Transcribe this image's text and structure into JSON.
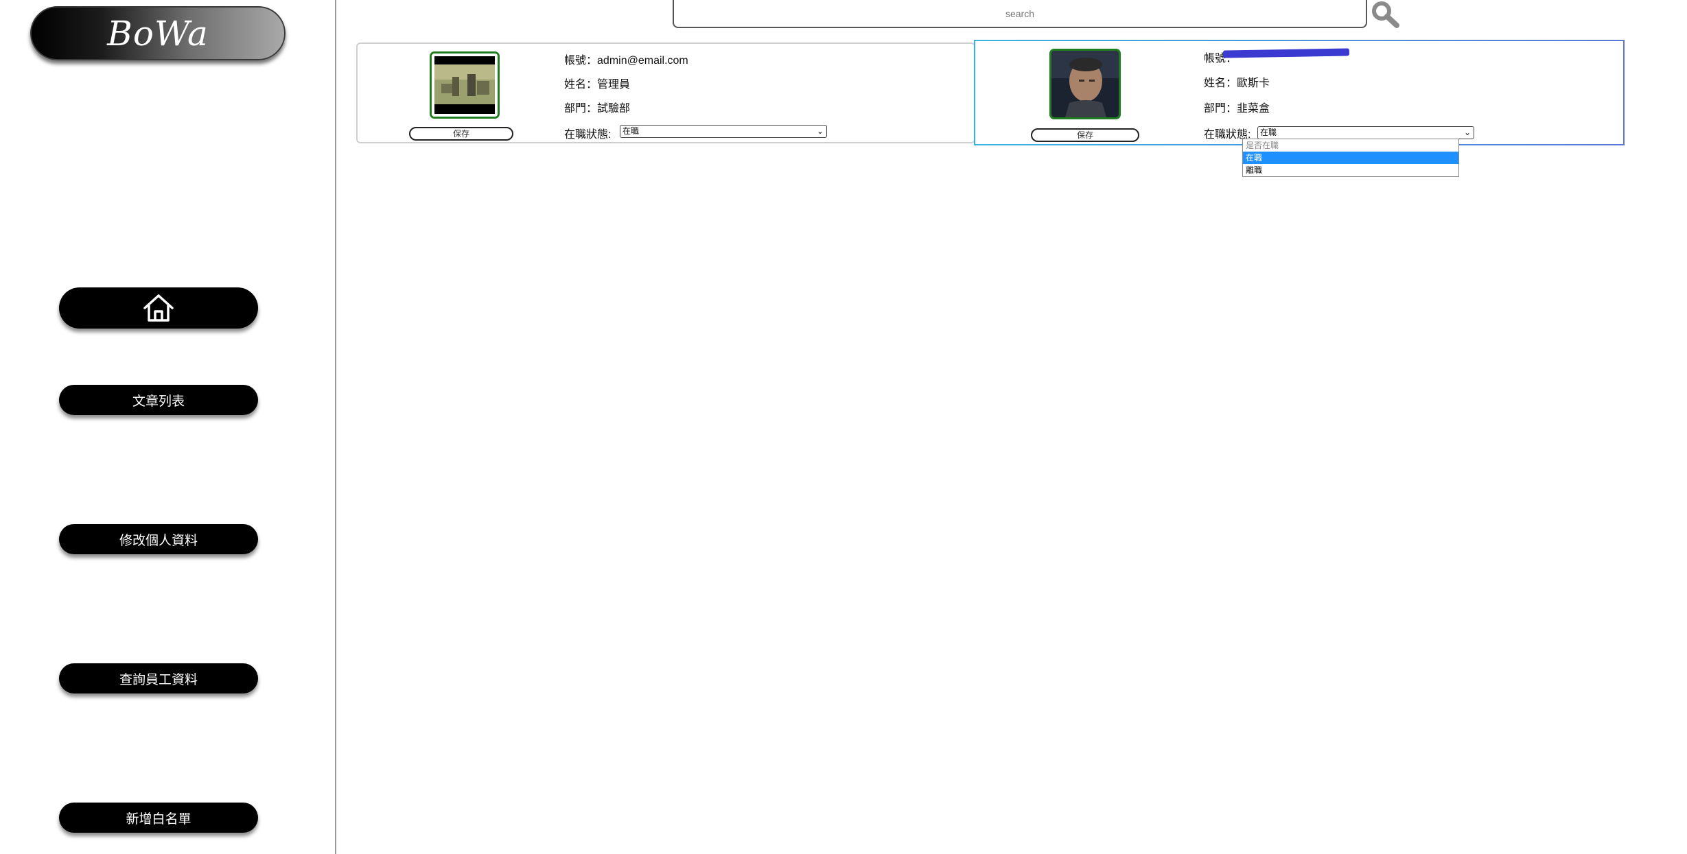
{
  "sidebar": {
    "logo": "BoWa",
    "nav": [
      "文章列表",
      "修改個人資料",
      "查詢員工資料",
      "新增白名單"
    ]
  },
  "search": {
    "placeholder": "search"
  },
  "cards": [
    {
      "account_label": "帳號：",
      "account": "admin@email.com",
      "name_label": "姓名：",
      "name": "管理員",
      "dept_label": "部門：",
      "dept": "試驗部",
      "status_label": "在職狀態:",
      "status": "在職",
      "save": "保存"
    },
    {
      "account_label": "帳號：",
      "account": "",
      "name_label": "姓名：",
      "name": "歐斯卡",
      "dept_label": "部門：",
      "dept": "韭菜盒",
      "status_label": "在職狀態:",
      "status": "在職",
      "save": "保存"
    }
  ],
  "dropdown": {
    "options": [
      "是否在職",
      "在職",
      "離職"
    ],
    "selected": "在職"
  },
  "colors": {
    "accent": "#1e90ff",
    "avatar_border": "#1f7d1f",
    "card_border": "#37b3e0"
  }
}
